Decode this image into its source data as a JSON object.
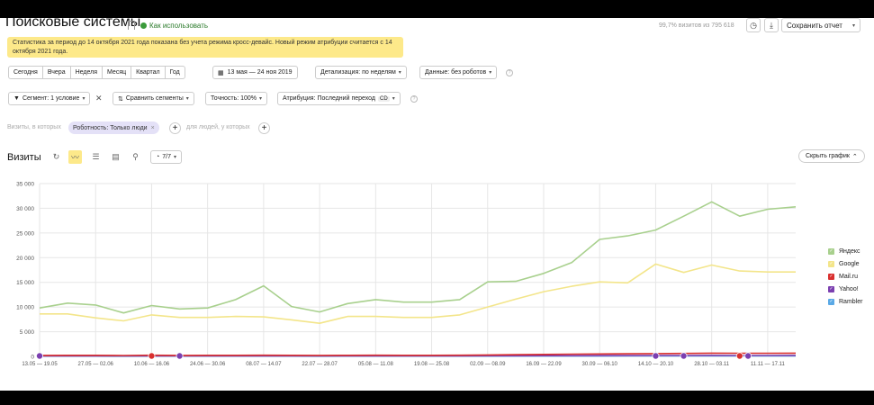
{
  "header": {
    "title": "Поисковые системы",
    "howto_label": "Как использовать",
    "visits_text": "99,7% визитов из 795 618",
    "save_label": "Сохранить отчет"
  },
  "notice": {
    "text": "Статистика за период до 14 октября 2021 года показана без учета режима кросс-девайс. Новый режим атрибуции считается с 14 октября 2021 года."
  },
  "period": {
    "presets": [
      "Сегодня",
      "Вчера",
      "Неделя",
      "Месяц",
      "Квартал",
      "Год"
    ],
    "range": "13 мая — 24 ноя 2019",
    "detail": "Детализация: по неделям",
    "data": "Данные: без роботов"
  },
  "options": {
    "segment": "Сегмент: 1 условие",
    "compare": "Сравнить сегменты",
    "accuracy": "Точность: 100%",
    "attribution": "Атрибуция: Последний переход",
    "attribution_badge": "CD"
  },
  "filters": {
    "label_visits": "Визиты, в которых",
    "chip": "Роботность: Только люди",
    "label_people": "для людей, у которых"
  },
  "chart_controls": {
    "metric": "Визиты",
    "series_count": "7/7",
    "hide_chart": "Скрыть график"
  },
  "colors": {
    "yandex": "#a8d08d",
    "google": "#f3e58a",
    "mailru": "#d9302f",
    "yahoo": "#7b3fb0",
    "rambler": "#5aa9e6",
    "grid": "#e6e6e6"
  },
  "chart_data": {
    "type": "line",
    "x": [
      "13.05 — 19.05",
      "20.05 — 26.05",
      "27.05 — 02.06",
      "03.06 — 09.06",
      "10.06 — 16.06",
      "17.06 — 23.06",
      "24.06 — 30.06",
      "01.07 — 07.07",
      "08.07 — 14.07",
      "15.07 — 21.07",
      "22.07 — 28.07",
      "29.07 — 04.08",
      "05.08 — 11.08",
      "12.08 — 18.08",
      "19.08 — 25.08",
      "26.08 — 01.09",
      "02.09 — 08.09",
      "09.09 — 15.09",
      "16.09 — 22.09",
      "23.09 — 29.09",
      "30.09 — 06.10",
      "07.10 — 13.10",
      "14.10 — 20.10",
      "21.10 — 27.10",
      "28.10 — 03.11",
      "04.11 — 10.11",
      "11.11 — 17.11",
      "18.11 — 24.11"
    ],
    "tick_labels": [
      "13.05 — 19.05",
      "27.05 — 02.06",
      "10.06 — 16.06",
      "24.06 — 30.06",
      "08.07 — 14.07",
      "22.07 — 28.07",
      "05.08 — 11.08",
      "19.08 — 25.08",
      "02.09 — 08.09",
      "16.09 — 22.09",
      "30.09 — 06.10",
      "14.10 — 20.10",
      "28.10 — 03.11",
      "11.11 — 17.11"
    ],
    "ylim": [
      0,
      35000
    ],
    "yticks": [
      0,
      5000,
      10000,
      15000,
      20000,
      25000,
      30000,
      35000
    ],
    "ytick_labels": [
      "0",
      "5 000",
      "10 000",
      "15 000",
      "20 000",
      "25 000",
      "30 000",
      "35 000"
    ],
    "grid": true,
    "legend_position": "right",
    "series": [
      {
        "name": "Яндекс",
        "color": "#a8d08d",
        "values": [
          9800,
          10800,
          10400,
          8800,
          10300,
          9600,
          9800,
          11500,
          14300,
          10100,
          9000,
          10700,
          11500,
          11000,
          11000,
          11500,
          15100,
          15200,
          16800,
          19000,
          23700,
          24400,
          25600,
          28400,
          31300,
          28400,
          29800,
          30300
        ]
      },
      {
        "name": "Google",
        "color": "#f3e58a",
        "values": [
          8600,
          8600,
          7800,
          7200,
          8400,
          7900,
          7900,
          8100,
          8000,
          7400,
          6700,
          8100,
          8100,
          7900,
          7900,
          8400,
          10000,
          11600,
          13100,
          14200,
          15100,
          14900,
          18700,
          17000,
          18500,
          17300,
          17100,
          17100
        ]
      },
      {
        "name": "Mail.ru",
        "color": "#d9302f",
        "values": [
          200,
          220,
          210,
          190,
          230,
          200,
          210,
          220,
          240,
          210,
          200,
          220,
          230,
          220,
          220,
          230,
          300,
          350,
          400,
          450,
          500,
          520,
          560,
          600,
          650,
          630,
          640,
          650
        ]
      },
      {
        "name": "Yahoo!",
        "color": "#7b3fb0",
        "values": [
          100,
          110,
          100,
          90,
          110,
          100,
          100,
          110,
          110,
          100,
          90,
          110,
          110,
          100,
          100,
          110,
          120,
          130,
          140,
          150,
          160,
          170,
          180,
          190,
          200,
          190,
          190,
          200
        ]
      },
      {
        "name": "Rambler",
        "color": "#5aa9e6",
        "values": [
          50,
          55,
          50,
          45,
          55,
          50,
          50,
          55,
          55,
          50,
          45,
          55,
          55,
          50,
          50,
          55,
          60,
          65,
          70,
          75,
          80,
          85,
          90,
          95,
          100,
          95,
          95,
          100
        ]
      }
    ]
  }
}
